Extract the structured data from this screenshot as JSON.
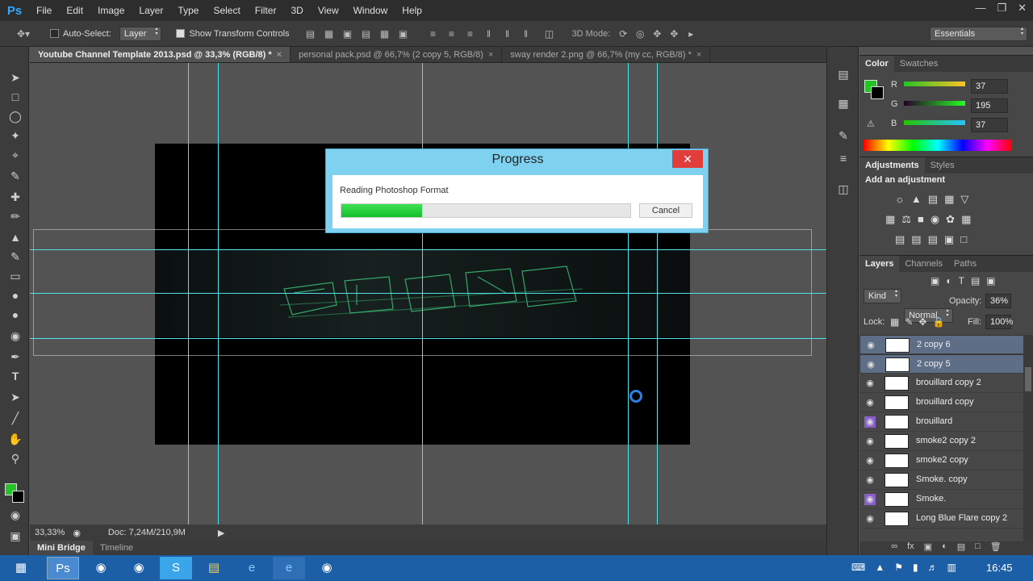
{
  "app": {
    "logo": "Ps"
  },
  "menu": [
    "File",
    "Edit",
    "Image",
    "Layer",
    "Type",
    "Select",
    "Filter",
    "3D",
    "View",
    "Window",
    "Help"
  ],
  "options": {
    "auto_select_label": "Auto-Select:",
    "auto_select_value": "Layer",
    "show_transform_label": "Show Transform Controls",
    "mode_label": "3D Mode:",
    "workspace": "Essentials"
  },
  "doc_tabs": [
    {
      "label": "Youtube Channel Template 2013.psd @ 33,3% (RGB/8) *"
    },
    {
      "label": "personal pack.psd @ 66,7% (2 copy 5, RGB/8)"
    },
    {
      "label": "sway render 2.png @ 66,7% (my cc, RGB/8) *"
    }
  ],
  "status": {
    "zoom": "33,33%",
    "doc": "Doc: 7,24M/210,9M"
  },
  "bottom_tabs": [
    "Mini Bridge",
    "Timeline"
  ],
  "color_panel": {
    "tabs": [
      "Color",
      "Swatches"
    ],
    "r_label": "R",
    "g_label": "G",
    "b_label": "B",
    "r": "37",
    "g": "195",
    "b": "37",
    "fg_color": "#25c325"
  },
  "adjustments": {
    "tabs": [
      "Adjustments",
      "Styles"
    ],
    "title": "Add an adjustment"
  },
  "layers_panel": {
    "tabs": [
      "Layers",
      "Channels",
      "Paths"
    ],
    "kind": "Kind",
    "blend_mode": "Normal",
    "opacity_label": "Opacity:",
    "opacity": "36%",
    "lock_label": "Lock:",
    "fill_label": "Fill:",
    "fill": "100%",
    "layers": [
      {
        "name": "2 copy 6",
        "selected": true
      },
      {
        "name": "2 copy 5",
        "selected": true
      },
      {
        "name": "brouillard copy 2",
        "selected": false
      },
      {
        "name": "brouillard copy",
        "selected": false
      },
      {
        "name": "brouillard",
        "selected": false
      },
      {
        "name": "smoke2 copy 2",
        "selected": false
      },
      {
        "name": "smoke2 copy",
        "selected": false
      },
      {
        "name": "Smoke. copy",
        "selected": false
      },
      {
        "name": "Smoke.",
        "selected": false
      },
      {
        "name": "Long Blue Flare copy 2",
        "selected": false
      }
    ]
  },
  "dialog": {
    "title": "Progress",
    "message": "Reading Photoshop Format",
    "cancel": "Cancel",
    "progress": 0.28
  },
  "taskbar": {
    "time": "16:45"
  }
}
